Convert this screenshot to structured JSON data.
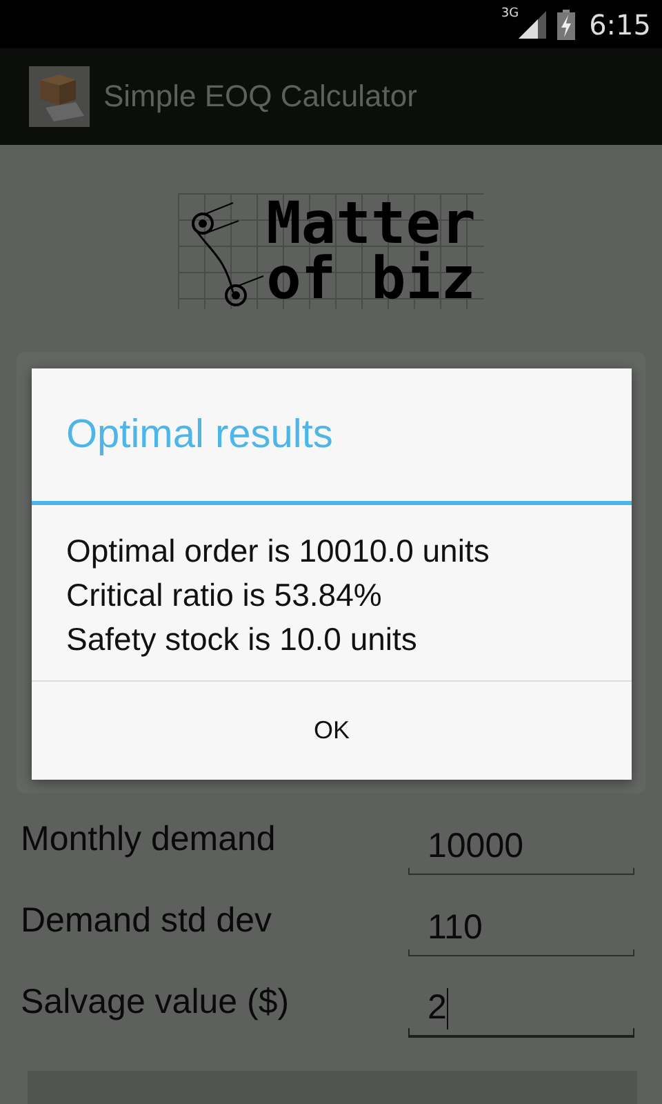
{
  "status_bar": {
    "network": "3G",
    "time": "6:15"
  },
  "action_bar": {
    "title": "Simple EOQ Calculator"
  },
  "logo": {
    "line_1": "Matter",
    "line_2": "of biz"
  },
  "rows": [
    {
      "label": "Monthly demand",
      "value": "10000",
      "focused": false
    },
    {
      "label": "Demand std dev",
      "value": "110",
      "focused": false
    },
    {
      "label": "Salvage value ($)",
      "value": "2",
      "focused": true
    }
  ],
  "dialog": {
    "title": "Optimal results",
    "lines": [
      "Optimal order is 10010.0 units",
      "Critical ratio is 53.84%",
      "Safety stock is 10.0 units"
    ],
    "button": "OK"
  }
}
